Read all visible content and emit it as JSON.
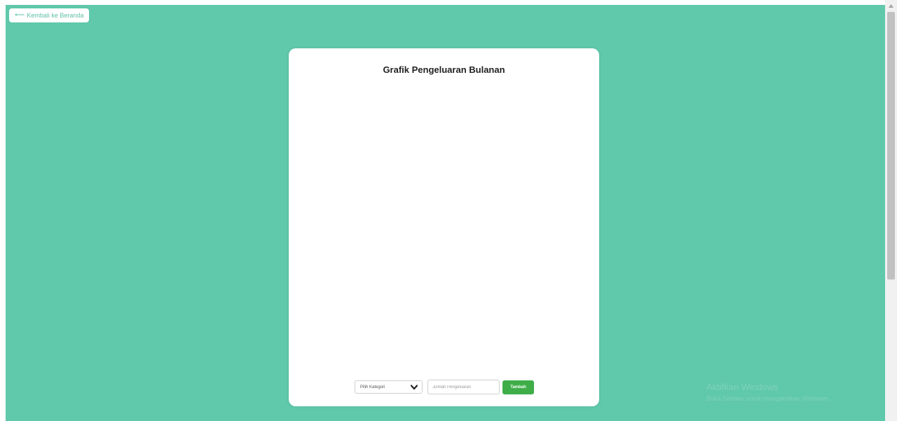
{
  "nav": {
    "back_arrow": "⟵",
    "back_label": "Kembali ke Beranda"
  },
  "card": {
    "title": "Grafik Pengeluaran Bulanan"
  },
  "form": {
    "category_selected": "Pilih Kategori",
    "amount_placeholder": "Jumlah Pengeluaran",
    "add_label": "Tambah"
  },
  "watermark": {
    "line1": "Aktifkan Windows",
    "line2": "Buka Setelan untuk mengaktifkan Windows."
  },
  "colors": {
    "background": "#60c8ab",
    "card": "#ffffff",
    "accent_button": "#3fae49",
    "back_text": "#5fbfa6"
  },
  "icons": {
    "back": "arrow-left-icon",
    "select": "chevron-down-icon",
    "scroll": "triangle-up-icon"
  }
}
